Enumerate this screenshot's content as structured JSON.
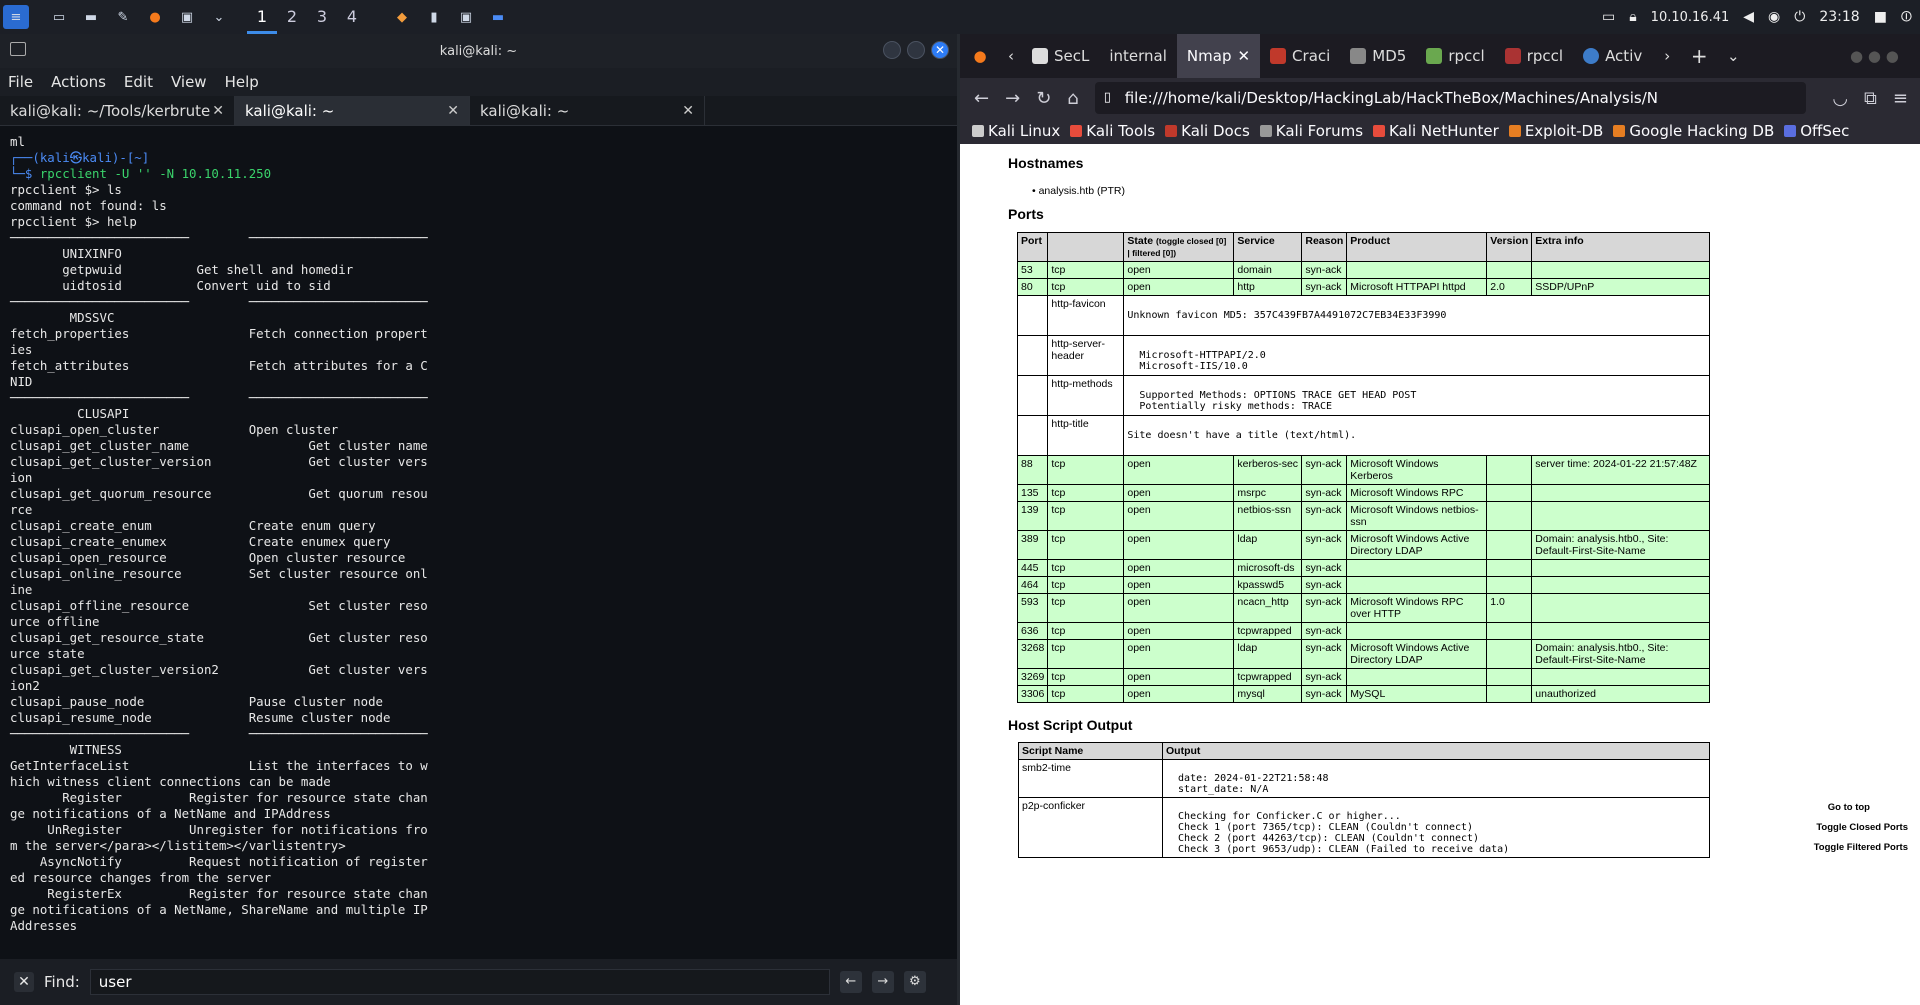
{
  "taskbar": {
    "workspaces": [
      "1",
      "2",
      "3",
      "4"
    ],
    "ip": "10.10.16.41",
    "clock": "23:18"
  },
  "terminal": {
    "window_title": "kali@kali: ~",
    "menu": [
      "File",
      "Actions",
      "Edit",
      "View",
      "Help"
    ],
    "tabs": [
      "kali@kali: ~/Tools/kerbrute",
      "kali@kali: ~",
      "kali@kali: ~"
    ],
    "lines_pre": [
      "ml"
    ],
    "prompt_user": "(kali㉿kali)-[~]",
    "command": "rpcclient -U '' -N 10.10.11.250",
    "output": [
      "rpcclient $> ls",
      "command not found: ls",
      "rpcclient $> help",
      "────────────────────────        ────────────────────────",
      "       UNIXINFO",
      "       getpwuid          Get shell and homedir",
      "       uidtosid          Convert uid to sid",
      "────────────────────────        ────────────────────────",
      "        MDSSVC",
      "fetch_properties                Fetch connection propert",
      "ies",
      "fetch_attributes                Fetch attributes for a C",
      "NID",
      "────────────────────────        ────────────────────────",
      "         CLUSAPI",
      "clusapi_open_cluster            Open cluster",
      "clusapi_get_cluster_name                Get cluster name",
      "clusapi_get_cluster_version             Get cluster vers",
      "ion",
      "clusapi_get_quorum_resource             Get quorum resou",
      "rce",
      "clusapi_create_enum             Create enum query",
      "clusapi_create_enumex           Create enumex query",
      "clusapi_open_resource           Open cluster resource",
      "clusapi_online_resource         Set cluster resource onl",
      "ine",
      "clusapi_offline_resource                Set cluster reso",
      "urce offline",
      "clusapi_get_resource_state              Get cluster reso",
      "urce state",
      "clusapi_get_cluster_version2            Get cluster vers",
      "ion2",
      "clusapi_pause_node              Pause cluster node",
      "clusapi_resume_node             Resume cluster node",
      "────────────────────────        ────────────────────────",
      "        WITNESS",
      "GetInterfaceList                List the interfaces to w",
      "hich witness client connections can be made",
      "       Register         Register for resource state chan",
      "ge notifications of a NetName and IPAddress",
      "     UnRegister         Unregister for notifications fro",
      "m the server</para></listitem></varlistentry>",
      "    AsyncNotify         Request notification of register",
      "ed resource changes from the server",
      "     RegisterEx         Register for resource state chan",
      "ge notifications of a NetName, ShareName and multiple IP",
      "Addresses"
    ],
    "find_label": "Find:",
    "find_value": "user"
  },
  "browser": {
    "tabs": [
      "SecL",
      "internal",
      "Nmap",
      "Craci",
      "MD5",
      "rpccl",
      "rpccl",
      "Activ"
    ],
    "active_tab": "Nmap",
    "url": "file:///home/kali/Desktop/HackingLab/HackTheBox/Machines/Analysis/N",
    "bookmarks": [
      "Kali Linux",
      "Kali Tools",
      "Kali Docs",
      "Kali Forums",
      "Kali NetHunter",
      "Exploit-DB",
      "Google Hacking DB",
      "OffSec"
    ]
  },
  "report": {
    "hostnames_title": "Hostnames",
    "hostname": "analysis.htb (PTR)",
    "ports_title": "Ports",
    "headers": [
      "Port",
      "",
      "State",
      "Service",
      "Reason",
      "Product",
      "Version",
      "Extra info"
    ],
    "state_sub": "(toggle closed [0] | filtered [0])",
    "rows": [
      {
        "type": "port",
        "port": "53",
        "proto": "tcp",
        "state": "open",
        "service": "domain",
        "reason": "syn-ack",
        "product": "",
        "version": "",
        "extra": ""
      },
      {
        "type": "port",
        "port": "80",
        "proto": "tcp",
        "state": "open",
        "service": "http",
        "reason": "syn-ack",
        "product": "Microsoft HTTPAPI httpd",
        "version": "2.0",
        "extra": "SSDP/UPnP"
      },
      {
        "type": "script",
        "name": "http-favicon",
        "output": "Unknown favicon MD5: 357C439FB7A4491072C7EB34E33F3990"
      },
      {
        "type": "script",
        "name": "http-server-header",
        "output": "\n  Microsoft-HTTPAPI/2.0\n  Microsoft-IIS/10.0"
      },
      {
        "type": "script",
        "name": "http-methods",
        "output": "\n  Supported Methods: OPTIONS TRACE GET HEAD POST\n  Potentially risky methods: TRACE"
      },
      {
        "type": "script",
        "name": "http-title",
        "output": "Site doesn't have a title (text/html)."
      },
      {
        "type": "port",
        "port": "88",
        "proto": "tcp",
        "state": "open",
        "service": "kerberos-sec",
        "reason": "syn-ack",
        "product": "Microsoft Windows Kerberos",
        "version": "",
        "extra": "server time: 2024-01-22 21:57:48Z"
      },
      {
        "type": "port",
        "port": "135",
        "proto": "tcp",
        "state": "open",
        "service": "msrpc",
        "reason": "syn-ack",
        "product": "Microsoft Windows RPC",
        "version": "",
        "extra": ""
      },
      {
        "type": "port",
        "port": "139",
        "proto": "tcp",
        "state": "open",
        "service": "netbios-ssn",
        "reason": "syn-ack",
        "product": "Microsoft Windows netbios-ssn",
        "version": "",
        "extra": ""
      },
      {
        "type": "port",
        "port": "389",
        "proto": "tcp",
        "state": "open",
        "service": "ldap",
        "reason": "syn-ack",
        "product": "Microsoft Windows Active Directory LDAP",
        "version": "",
        "extra": "Domain: analysis.htb0., Site: Default-First-Site-Name"
      },
      {
        "type": "port",
        "port": "445",
        "proto": "tcp",
        "state": "open",
        "service": "microsoft-ds",
        "reason": "syn-ack",
        "product": "",
        "version": "",
        "extra": ""
      },
      {
        "type": "port",
        "port": "464",
        "proto": "tcp",
        "state": "open",
        "service": "kpasswd5",
        "reason": "syn-ack",
        "product": "",
        "version": "",
        "extra": ""
      },
      {
        "type": "port",
        "port": "593",
        "proto": "tcp",
        "state": "open",
        "service": "ncacn_http",
        "reason": "syn-ack",
        "product": "Microsoft Windows RPC over HTTP",
        "version": "1.0",
        "extra": ""
      },
      {
        "type": "port",
        "port": "636",
        "proto": "tcp",
        "state": "open",
        "service": "tcpwrapped",
        "reason": "syn-ack",
        "product": "",
        "version": "",
        "extra": ""
      },
      {
        "type": "port",
        "port": "3268",
        "proto": "tcp",
        "state": "open",
        "service": "ldap",
        "reason": "syn-ack",
        "product": "Microsoft Windows Active Directory LDAP",
        "version": "",
        "extra": "Domain: analysis.htb0., Site: Default-First-Site-Name"
      },
      {
        "type": "port",
        "port": "3269",
        "proto": "tcp",
        "state": "open",
        "service": "tcpwrapped",
        "reason": "syn-ack",
        "product": "",
        "version": "",
        "extra": ""
      },
      {
        "type": "port",
        "port": "3306",
        "proto": "tcp",
        "state": "open",
        "service": "mysql",
        "reason": "syn-ack",
        "product": "MySQL",
        "version": "",
        "extra": "unauthorized"
      }
    ],
    "hso_title": "Host Script Output",
    "hso_headers": [
      "Script Name",
      "Output"
    ],
    "hso_rows": [
      {
        "name": "smb2-time",
        "output": "\n  date: 2024-01-22T21:58:48\n  start_date: N/A"
      },
      {
        "name": "p2p-conficker",
        "output": "\n  Checking for Conficker.C or higher...\n  Check 1 (port 7365/tcp): CLEAN (Couldn't connect)\n  Check 2 (port 44263/tcp): CLEAN (Couldn't connect)\n  Check 3 (port 9653/udp): CLEAN (Failed to receive data)"
      }
    ],
    "side_links": [
      "Go to top",
      "Toggle Closed Ports",
      "Toggle Filtered Ports"
    ]
  }
}
